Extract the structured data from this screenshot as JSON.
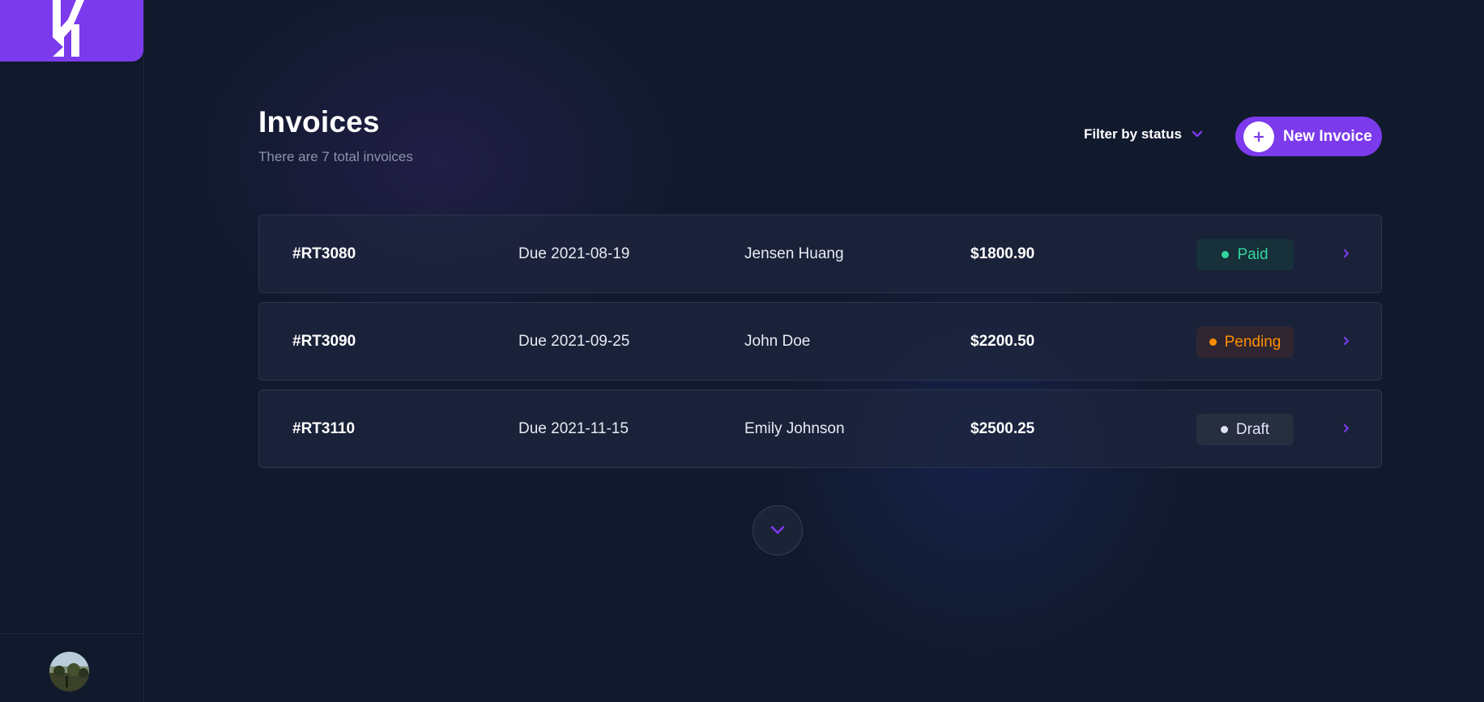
{
  "header": {
    "title": "Invoices",
    "subtitle": "There are 7 total invoices",
    "filter_label": "Filter by status",
    "new_invoice_label": "New Invoice"
  },
  "invoices": [
    {
      "id": "#RT3080",
      "due": "Due 2021-08-19",
      "client": "Jensen Huang",
      "amount": "$1800.90",
      "status": "Paid"
    },
    {
      "id": "#RT3090",
      "due": "Due 2021-09-25",
      "client": "John Doe",
      "amount": "$2200.50",
      "status": "Pending"
    },
    {
      "id": "#RT3110",
      "due": "Due 2021-11-15",
      "client": "Emily Johnson",
      "amount": "$2500.25",
      "status": "Draft"
    }
  ],
  "status_colors": {
    "Paid": {
      "text": "#33d69f",
      "bg": "#17303a"
    },
    "Pending": {
      "text": "#ff8f00",
      "bg": "#2f2530"
    },
    "Draft": {
      "text": "#dfe3fa",
      "bg": "#262e40"
    }
  },
  "theme": {
    "accent": "#7c3aed",
    "background": "#111a2d",
    "card": "#1f263e"
  },
  "icons": {
    "logo": "brand-logo-icon",
    "filter": "chevron-down-icon",
    "new_invoice": "plus-icon",
    "row": "chevron-right-icon",
    "load_more": "chevron-down-icon",
    "profile": "avatar"
  }
}
